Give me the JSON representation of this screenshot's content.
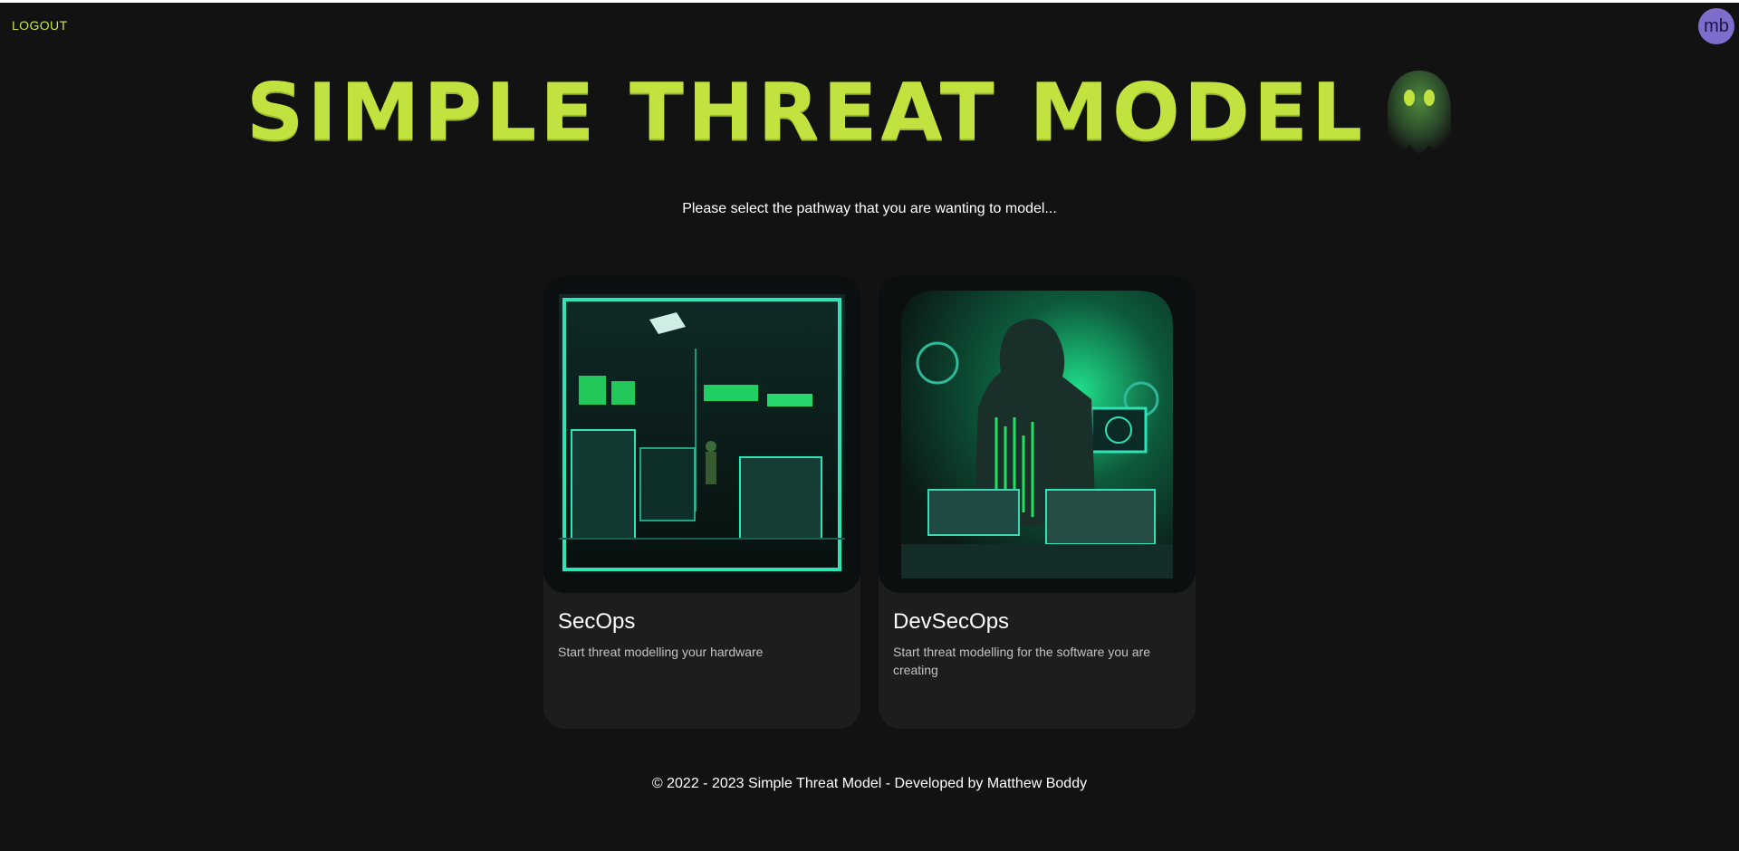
{
  "header": {
    "logout_label": "LOGOUT",
    "avatar_initials": "mb",
    "title": "SIMPLE THREAT MODEL"
  },
  "main": {
    "prompt": "Please select the pathway that you are wanting to model...",
    "cards": [
      {
        "title": "SecOps",
        "description": "Start threat modelling your hardware",
        "image_icon": "server-room-illustration"
      },
      {
        "title": "DevSecOps",
        "description": "Start threat modelling for the software you are creating",
        "image_icon": "hooded-hacker-illustration"
      }
    ]
  },
  "footer": {
    "copyright": "© 2022 - 2023 Simple Threat Model - Developed by Matthew Boddy"
  },
  "colors": {
    "background": "#121212",
    "accent": "#c2e23f",
    "card": "#1d1d1d",
    "avatar": "#7e6dcd",
    "image_glow": "#1fe08a"
  }
}
